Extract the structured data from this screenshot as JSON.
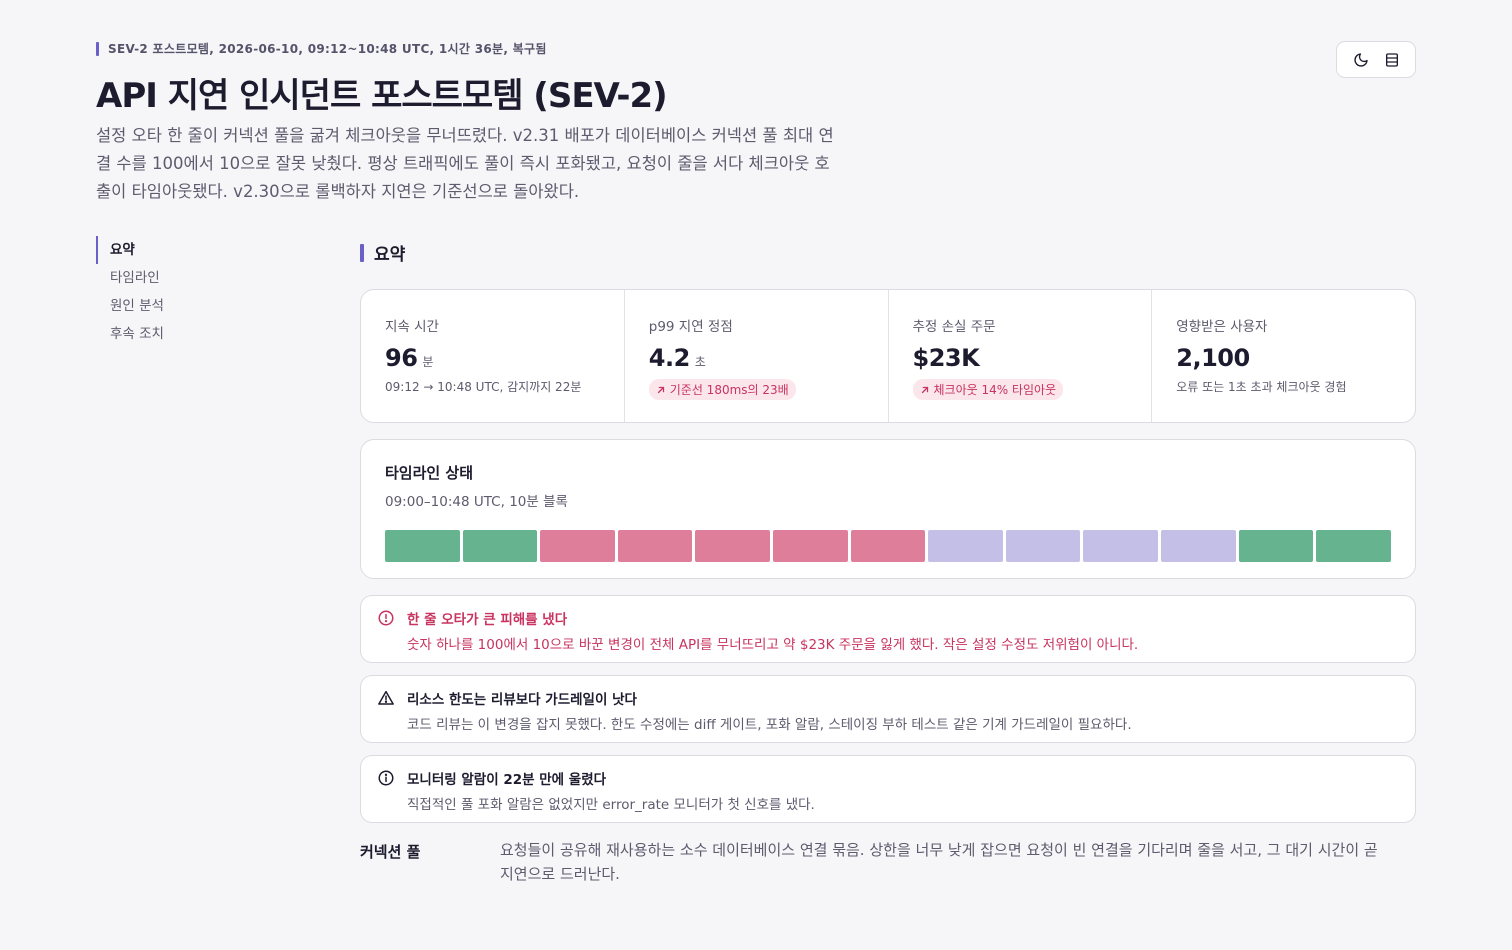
{
  "header": {
    "eyebrow": "SEV-2 포스트모템, 2026-06-10, 09:12~10:48 UTC, 1시간 36분, 복구됨",
    "title": "API 지연 인시던트 포스트모템 (SEV-2)",
    "lede": "설정 오타 한 줄이 커넥션 풀을 굶겨 체크아웃을 무너뜨렸다. v2.31 배포가 데이터베이스 커넥션 풀 최대 연결 수를 100에서 10으로 잘못 낮췄다. 평상 트래픽에도 풀이 즉시 포화됐고, 요청이 줄을 서다 체크아웃 호출이 타임아웃됐다. v2.30으로 롤백하자 지연은 기준선으로 돌아왔다."
  },
  "toolbar": {
    "theme_icon": "moon-icon",
    "layout_icon": "layout-icon"
  },
  "toc": {
    "items": [
      "요약",
      "타임라인",
      "원인 분석",
      "후속 조치"
    ],
    "active_index": 0
  },
  "summary": {
    "heading": "요약",
    "stats": [
      {
        "label": "지속 시간",
        "value": "96",
        "unit": "분",
        "note": "09:12 → 10:48 UTC, 감지까지 22분"
      },
      {
        "label": "p99 지연 정점",
        "value": "4.2",
        "unit": "초",
        "badge": "기준선 180ms의 23배"
      },
      {
        "label": "추정 손실 주문",
        "value": "$23K",
        "badge": "체크아웃 14% 타임아웃"
      },
      {
        "label": "영향받은 사용자",
        "value": "2,100",
        "note": "오류 또는 1초 초과 체크아웃 경험"
      }
    ]
  },
  "timeline": {
    "title": "타임라인 상태",
    "subtitle": "09:00–10:48 UTC, 10분 블록",
    "blocks": [
      "ok",
      "ok",
      "bad",
      "bad",
      "bad",
      "bad",
      "bad",
      "rec",
      "rec",
      "rec",
      "rec",
      "ok",
      "ok"
    ],
    "colors": {
      "ok": "#66b48f",
      "bad": "#df7e9a",
      "rec": "#c4bfe6"
    }
  },
  "callouts": [
    {
      "kind": "danger",
      "icon": "alert-circle-icon",
      "title": "한 줄 오타가 큰 피해를 냈다",
      "body": "숫자 하나를 100에서 10으로 바꾼 변경이 전체 API를 무너뜨리고 약 $23K 주문을 잃게 했다. 작은 설정 수정도 저위험이 아니다."
    },
    {
      "kind": "warning",
      "icon": "warning-triangle-icon",
      "title": "리소스 한도는 리뷰보다 가드레일이 낫다",
      "body": "코드 리뷰는 이 변경을 잡지 못했다. 한도 수정에는 diff 게이트, 포화 알람, 스테이징 부하 테스트 같은 기계 가드레일이 필요하다."
    },
    {
      "kind": "info",
      "icon": "info-circle-icon",
      "title": "모니터링 알람이 22분 만에 울렸다",
      "body": "직접적인 풀 포화 알람은 없었지만 error_rate 모니터가 첫 신호를 냈다."
    }
  ],
  "glossary": {
    "term": "커넥션 풀",
    "definition": "요청들이 공유해 재사용하는 소수 데이터베이스 연결 묶음. 상한을 너무 낮게 잡으면 요청이 빈 연결을 기다리며 줄을 서고, 그 대기 시간이 곧 지연으로 드러난다."
  },
  "colors": {
    "accent": "#6b5fc8",
    "danger": "#c8335f",
    "danger_bg": "#fbe6ec"
  }
}
